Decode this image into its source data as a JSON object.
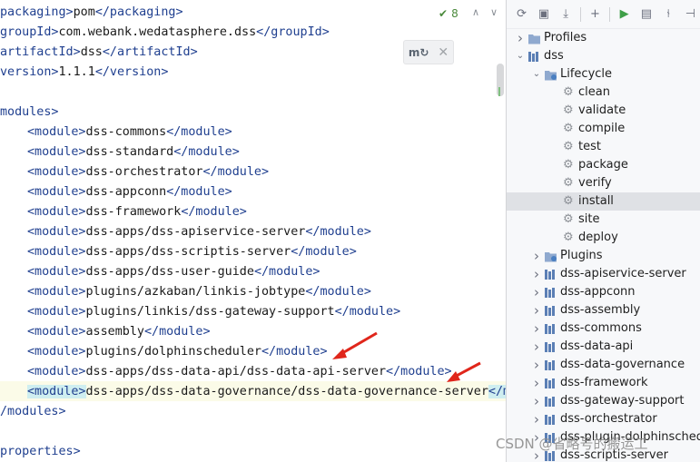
{
  "editor": {
    "inspection_count": "8",
    "lines": [
      {
        "parts": [
          {
            "t": "tag",
            "v": "packaging>"
          },
          {
            "t": "txt",
            "v": "pom"
          },
          {
            "t": "tag",
            "v": "</packaging>"
          }
        ]
      },
      {
        "parts": [
          {
            "t": "tag",
            "v": "groupId>"
          },
          {
            "t": "txt",
            "v": "com.webank.wedatasphere.dss"
          },
          {
            "t": "tag",
            "v": "</groupId>"
          }
        ]
      },
      {
        "parts": [
          {
            "t": "tag",
            "v": "artifactId>"
          },
          {
            "t": "txt",
            "v": "dss"
          },
          {
            "t": "tag",
            "v": "</artifactId>"
          }
        ]
      },
      {
        "parts": [
          {
            "t": "tag",
            "v": "version>"
          },
          {
            "t": "txt",
            "v": "1.1.1"
          },
          {
            "t": "tag",
            "v": "</version>"
          }
        ]
      },
      {
        "parts": []
      },
      {
        "parts": [
          {
            "t": "tag",
            "v": "modules>"
          }
        ]
      },
      {
        "parts": [
          {
            "t": "tag",
            "v": "<module>"
          },
          {
            "t": "txt",
            "v": "dss-commons"
          },
          {
            "t": "tag",
            "v": "</module>"
          }
        ],
        "indent": true
      },
      {
        "parts": [
          {
            "t": "tag",
            "v": "<module>"
          },
          {
            "t": "txt",
            "v": "dss-standard"
          },
          {
            "t": "tag",
            "v": "</module>"
          }
        ],
        "indent": true
      },
      {
        "parts": [
          {
            "t": "tag",
            "v": "<module>"
          },
          {
            "t": "txt",
            "v": "dss-orchestrator"
          },
          {
            "t": "tag",
            "v": "</module>"
          }
        ],
        "indent": true
      },
      {
        "parts": [
          {
            "t": "tag",
            "v": "<module>"
          },
          {
            "t": "txt",
            "v": "dss-appconn"
          },
          {
            "t": "tag",
            "v": "</module>"
          }
        ],
        "indent": true
      },
      {
        "parts": [
          {
            "t": "tag",
            "v": "<module>"
          },
          {
            "t": "txt",
            "v": "dss-framework"
          },
          {
            "t": "tag",
            "v": "</module>"
          }
        ],
        "indent": true
      },
      {
        "parts": [
          {
            "t": "tag",
            "v": "<module>"
          },
          {
            "t": "txt",
            "v": "dss-apps/dss-apiservice-server"
          },
          {
            "t": "tag",
            "v": "</module>"
          }
        ],
        "indent": true
      },
      {
        "parts": [
          {
            "t": "tag",
            "v": "<module>"
          },
          {
            "t": "txt",
            "v": "dss-apps/dss-scriptis-server"
          },
          {
            "t": "tag",
            "v": "</module>"
          }
        ],
        "indent": true
      },
      {
        "parts": [
          {
            "t": "tag",
            "v": "<module>"
          },
          {
            "t": "txt",
            "v": "dss-apps/dss-user-guide"
          },
          {
            "t": "tag",
            "v": "</module>"
          }
        ],
        "indent": true
      },
      {
        "parts": [
          {
            "t": "tag",
            "v": "<module>"
          },
          {
            "t": "txt",
            "v": "plugins/azkaban/linkis-jobtype"
          },
          {
            "t": "tag",
            "v": "</module>"
          }
        ],
        "indent": true
      },
      {
        "parts": [
          {
            "t": "tag",
            "v": "<module>"
          },
          {
            "t": "txt",
            "v": "plugins/linkis/dss-gateway-support"
          },
          {
            "t": "tag",
            "v": "</module>"
          }
        ],
        "indent": true
      },
      {
        "parts": [
          {
            "t": "tag",
            "v": "<module>"
          },
          {
            "t": "txt",
            "v": "assembly"
          },
          {
            "t": "tag",
            "v": "</module>"
          }
        ],
        "indent": true
      },
      {
        "parts": [
          {
            "t": "tag",
            "v": "<module>"
          },
          {
            "t": "txt",
            "v": "plugins/dolphinscheduler"
          },
          {
            "t": "tag",
            "v": "</module>"
          }
        ],
        "indent": true
      },
      {
        "parts": [
          {
            "t": "tag",
            "v": "<module>"
          },
          {
            "t": "txt",
            "v": "dss-apps/dss-data-api/dss-data-api-server"
          },
          {
            "t": "tag",
            "v": "</module>"
          }
        ],
        "indent": true
      },
      {
        "parts": [
          {
            "t": "tag",
            "v": "<module>"
          },
          {
            "t": "txt",
            "v": "dss-apps/dss-data-governance/dss-data-governance-server"
          },
          {
            "t": "tag",
            "v": "</m"
          }
        ],
        "indent": true,
        "highlight": true
      },
      {
        "parts": [
          {
            "t": "tag",
            "v": "/modules>"
          }
        ]
      },
      {
        "parts": []
      },
      {
        "parts": [
          {
            "t": "tag",
            "v": "properties>"
          }
        ]
      }
    ]
  },
  "maven": {
    "tree": [
      {
        "label": "Profiles",
        "level": 0,
        "arrow": "right",
        "icon": "folder-icon"
      },
      {
        "label": "dss",
        "level": 0,
        "arrow": "down",
        "icon": "maven-module-icon"
      },
      {
        "label": "Lifecycle",
        "level": 1,
        "arrow": "down",
        "icon": "folder-gear-icon"
      },
      {
        "label": "clean",
        "level": 2,
        "arrow": "",
        "icon": "gear-icon"
      },
      {
        "label": "validate",
        "level": 2,
        "arrow": "",
        "icon": "gear-icon"
      },
      {
        "label": "compile",
        "level": 2,
        "arrow": "",
        "icon": "gear-icon"
      },
      {
        "label": "test",
        "level": 2,
        "arrow": "",
        "icon": "gear-icon"
      },
      {
        "label": "package",
        "level": 2,
        "arrow": "",
        "icon": "gear-icon"
      },
      {
        "label": "verify",
        "level": 2,
        "arrow": "",
        "icon": "gear-icon"
      },
      {
        "label": "install",
        "level": 2,
        "arrow": "",
        "icon": "gear-icon",
        "selected": true
      },
      {
        "label": "site",
        "level": 2,
        "arrow": "",
        "icon": "gear-icon"
      },
      {
        "label": "deploy",
        "level": 2,
        "arrow": "",
        "icon": "gear-icon"
      },
      {
        "label": "Plugins",
        "level": 1,
        "arrow": "right",
        "icon": "folder-gear-icon"
      },
      {
        "label": "dss-apiservice-server",
        "level": 1,
        "arrow": "right",
        "icon": "maven-module-icon"
      },
      {
        "label": "dss-appconn",
        "level": 1,
        "arrow": "right",
        "icon": "maven-module-icon"
      },
      {
        "label": "dss-assembly",
        "level": 1,
        "arrow": "right",
        "icon": "maven-module-icon"
      },
      {
        "label": "dss-commons",
        "level": 1,
        "arrow": "right",
        "icon": "maven-module-icon"
      },
      {
        "label": "dss-data-api",
        "level": 1,
        "arrow": "right",
        "icon": "maven-module-icon"
      },
      {
        "label": "dss-data-governance",
        "level": 1,
        "arrow": "right",
        "icon": "maven-module-icon"
      },
      {
        "label": "dss-framework",
        "level": 1,
        "arrow": "right",
        "icon": "maven-module-icon"
      },
      {
        "label": "dss-gateway-support",
        "level": 1,
        "arrow": "right",
        "icon": "maven-module-icon"
      },
      {
        "label": "dss-orchestrator",
        "level": 1,
        "arrow": "right",
        "icon": "maven-module-icon"
      },
      {
        "label": "dss-plugin-dolphinschedu",
        "level": 1,
        "arrow": "right",
        "icon": "maven-module-icon"
      },
      {
        "label": "dss-scriptis-server",
        "level": 1,
        "arrow": "right",
        "icon": "maven-module-icon"
      }
    ],
    "toolbar": [
      "reload-icon",
      "add-source-icon",
      "download-icon",
      "plus-icon",
      "run-icon",
      "run-config-icon",
      "skip-tests-icon",
      "lifecycle-icon"
    ]
  },
  "watermark": "CSDN @省略号的搬运工",
  "colors": {
    "tag": "#1f3f8f",
    "arrow": "#e0261b",
    "selected": "#dfe1e5"
  }
}
